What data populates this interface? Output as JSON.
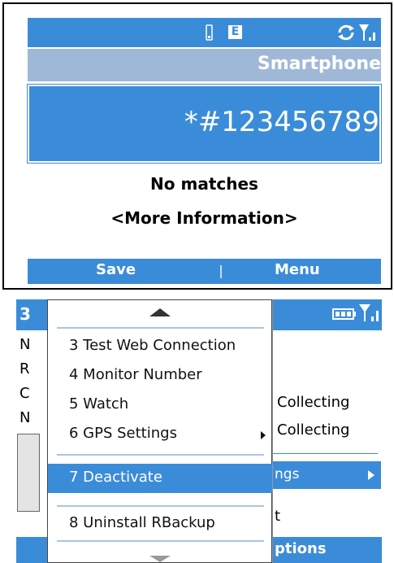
{
  "top_screen": {
    "status": {
      "network_badge": "E",
      "icons": [
        "battery-low-icon",
        "edge-network-icon",
        "sync-signal-icon"
      ]
    },
    "title": "Smartphone",
    "dial_input": "*#123456789",
    "results": {
      "no_matches": "No matches",
      "more_info": "<More Information>"
    },
    "softkeys": {
      "left": "Save",
      "right": "Menu"
    }
  },
  "bottom_screen": {
    "status": {
      "time_partial": "3",
      "icons": [
        "battery-full-icon",
        "signal-strength-icon"
      ]
    },
    "background_list": {
      "left_letters": [
        "N",
        "R",
        "C",
        "N"
      ],
      "right_items": [
        "Collecting",
        "Collecting"
      ],
      "selected_partial": "ngs",
      "below_partial": "t"
    },
    "softkey_right_partial": "ptions",
    "popup_menu": {
      "items": [
        {
          "number": "3",
          "label": "3 Test Web Connection"
        },
        {
          "number": "4",
          "label": "4 Monitor Number"
        },
        {
          "number": "5",
          "label": "5 Watch"
        },
        {
          "number": "6",
          "label": "6 GPS Settings",
          "has_submenu": true
        },
        {
          "number": "7",
          "label": "7 Deactivate",
          "selected": true
        },
        {
          "number": "8",
          "label": "8 Uninstall RBackup"
        }
      ]
    }
  },
  "colors": {
    "accent_blue": "#3b8cd8",
    "title_bar": "#a0b8d8",
    "separator": "#a8c4e8"
  }
}
